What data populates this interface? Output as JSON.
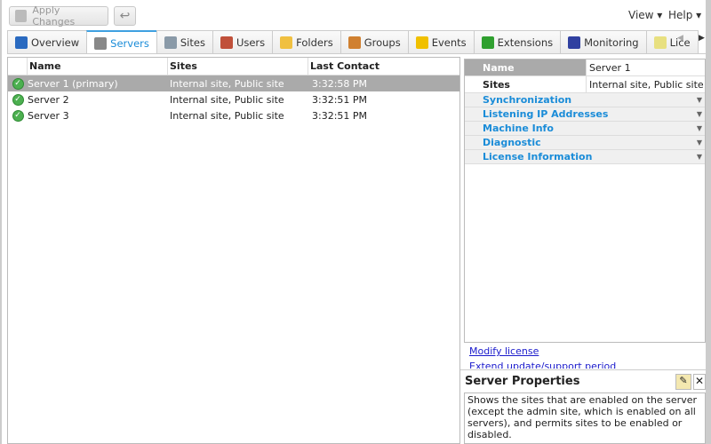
{
  "toolbar": {
    "apply_label": "Apply Changes",
    "undo_icon": "undo-icon"
  },
  "menu": {
    "view": "View",
    "help": "Help"
  },
  "tabs": [
    {
      "label": "Overview",
      "icon": "overview-icon",
      "color": "#2a6ac0"
    },
    {
      "label": "Servers",
      "icon": "server-icon",
      "color": "#888888"
    },
    {
      "label": "Sites",
      "icon": "sites-icon",
      "color": "#8a9aa8"
    },
    {
      "label": "Users",
      "icon": "user-icon",
      "color": "#c0503a"
    },
    {
      "label": "Folders",
      "icon": "folder-icon",
      "color": "#f0c040"
    },
    {
      "label": "Groups",
      "icon": "groups-icon",
      "color": "#d08030"
    },
    {
      "label": "Events",
      "icon": "lightning-icon",
      "color": "#f0c000"
    },
    {
      "label": "Extensions",
      "icon": "puzzle-icon",
      "color": "#30a030"
    },
    {
      "label": "Monitoring",
      "icon": "monitoring-icon",
      "color": "#3040a0"
    },
    {
      "label": "Lice",
      "icon": "license-icon",
      "color": "#e8e080"
    }
  ],
  "active_tab": 1,
  "servers": {
    "columns": [
      "Name",
      "Sites",
      "Last Contact"
    ],
    "rows": [
      {
        "name": "Server 1 (primary)",
        "sites": "Internal site, Public site",
        "last": "3:32:58 PM"
      },
      {
        "name": "Server 2",
        "sites": "Internal site, Public site",
        "last": "3:32:51 PM"
      },
      {
        "name": "Server 3",
        "sites": "Internal site, Public site",
        "last": "3:32:51 PM"
      }
    ]
  },
  "details": {
    "name_label": "Name",
    "name_value": "Server 1",
    "sites_label": "Sites",
    "sites_value": "Internal site, Public site",
    "sections": [
      "Synchronization",
      "Listening IP Addresses",
      "Machine Info",
      "Diagnostic",
      "License Information"
    ]
  },
  "links": {
    "modify": "Modify license",
    "extend": "Extend update/support period"
  },
  "properties": {
    "title": "Server Properties",
    "description": "Shows the sites that are enabled on the server (except the admin site, which is enabled on all servers), and permits sites to be enabled or disabled."
  }
}
